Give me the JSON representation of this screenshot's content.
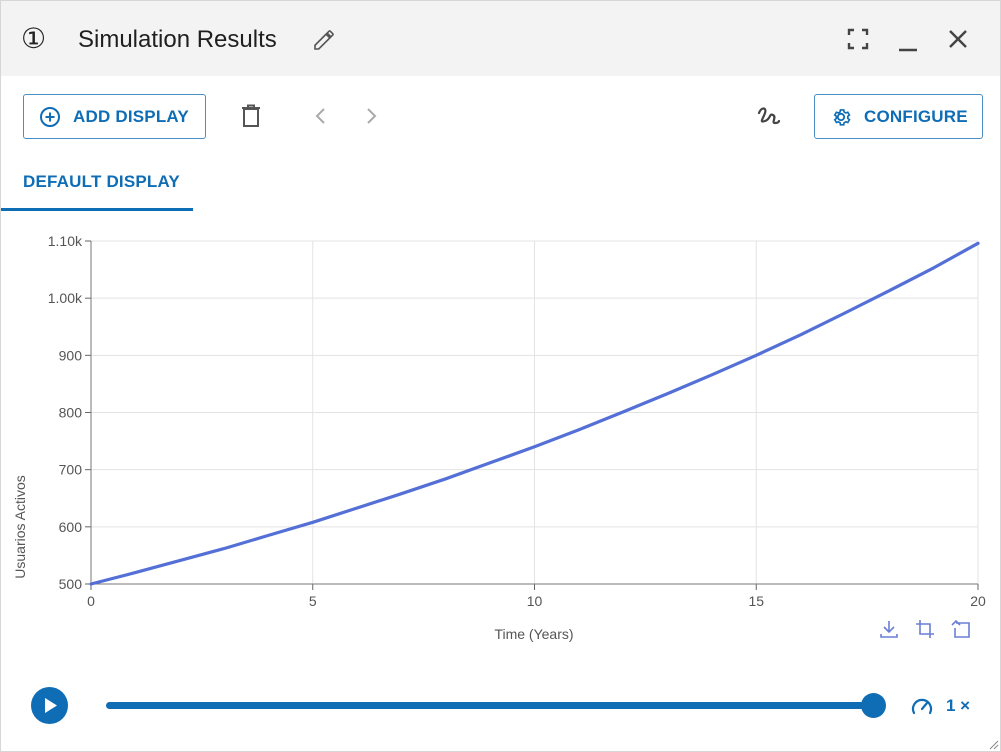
{
  "window": {
    "number": "①",
    "title": "Simulation Results"
  },
  "toolbar": {
    "add_display_label": "ADD DISPLAY",
    "configure_label": "CONFIGURE"
  },
  "tabs": [
    {
      "label": "DEFAULT DISPLAY",
      "active": true
    }
  ],
  "chart_data": {
    "type": "line",
    "title": "",
    "xlabel": "Time (Years)",
    "ylabel": "Usuarios Activos",
    "xlim": [
      0,
      20
    ],
    "ylim": [
      500,
      1100
    ],
    "x_ticks": [
      0,
      5,
      10,
      15,
      20
    ],
    "y_ticks": [
      500,
      600,
      700,
      800,
      900,
      1000,
      1100
    ],
    "y_tick_labels": [
      "500",
      "600",
      "700",
      "800",
      "900",
      "1.00k",
      "1.10k"
    ],
    "grid": true,
    "series": [
      {
        "color": "#5470d6",
        "x": [
          0,
          1,
          2,
          3,
          4,
          5,
          6,
          7,
          8,
          9,
          10,
          11,
          12,
          13,
          14,
          15,
          16,
          17,
          18,
          19,
          20
        ],
        "y": [
          500,
          520,
          541,
          562,
          585,
          608,
          633,
          658,
          684,
          712,
          740,
          770,
          801,
          833,
          866,
          900,
          936,
          974,
          1013,
          1053,
          1096
        ]
      }
    ]
  },
  "playback": {
    "progress": 1.0,
    "speed_label": "1 ×"
  },
  "colors": {
    "accent": "#0f6db5",
    "line": "#5470d6",
    "titlebar_bg": "#f3f3f3"
  },
  "icons": {
    "edit": "pencil-icon",
    "fullscreen": "fullscreen-icon",
    "minimize": "minimize-icon",
    "close": "close-icon",
    "add": "plus-circle-icon",
    "delete": "trash-icon",
    "prev": "chevron-left-icon",
    "next": "chevron-right-icon",
    "draw": "squiggle-icon",
    "settings": "gear-icon",
    "download": "download-icon",
    "zoom": "crop-icon",
    "reset": "reset-icon",
    "play": "play-icon",
    "speed": "speedometer-icon"
  }
}
